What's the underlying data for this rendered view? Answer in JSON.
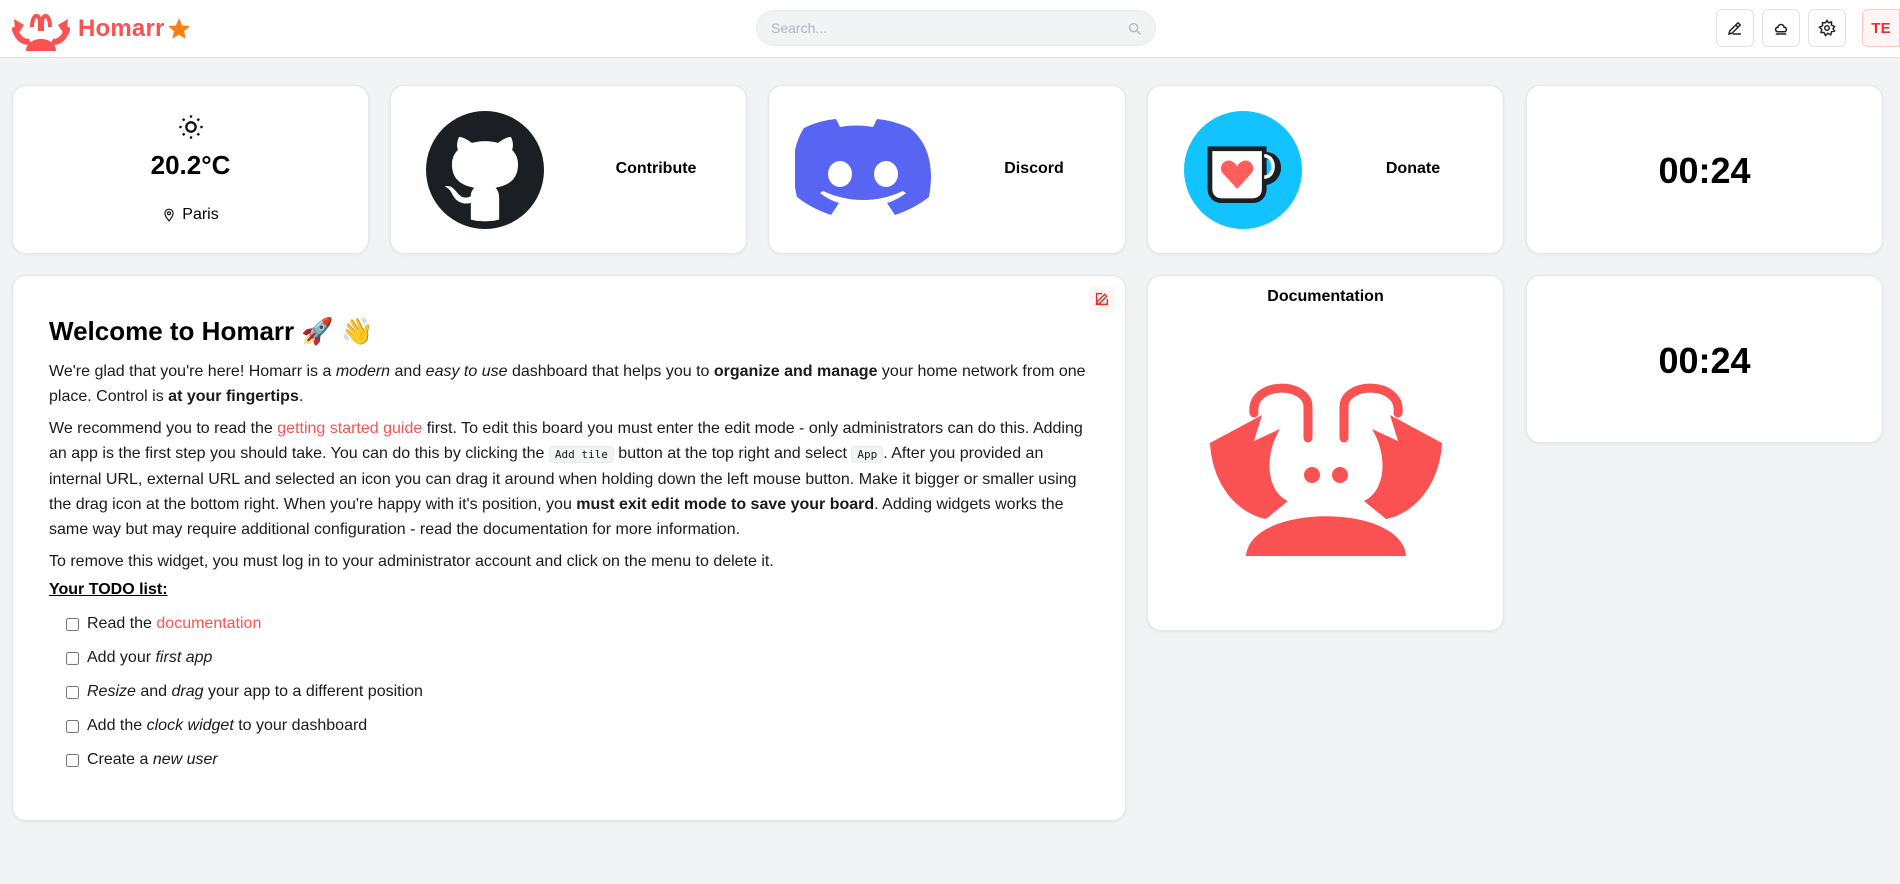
{
  "header": {
    "brand": "Homarr",
    "search_placeholder": "Search...",
    "avatar_initials": "TE",
    "colors": {
      "accent": "#fa5252",
      "star": "#fd7e14"
    }
  },
  "weather": {
    "temperature": "20.2°C",
    "location": "Paris"
  },
  "apps": [
    {
      "label": "Contribute",
      "icon": "github-icon"
    },
    {
      "label": "Discord",
      "icon": "discord-icon"
    },
    {
      "label": "Donate",
      "icon": "ko-fi-icon"
    }
  ],
  "clocks": [
    {
      "time": "00:24"
    },
    {
      "time": "00:24"
    }
  ],
  "documentation": {
    "label": "Documentation",
    "icon": "homarr-logo-icon"
  },
  "welcome": {
    "title": "Welcome to Homarr",
    "title_emoji": "🚀 👋",
    "p1": {
      "t1": "We're glad that you're here! Homarr is a ",
      "i1": "modern",
      "t2": " and ",
      "i2": "easy to use",
      "t3": " dashboard that helps you to ",
      "b1": "organize and manage",
      "t4": " your home network from one place. Control is ",
      "b2": "at your fingertips",
      "t5": "."
    },
    "p2": {
      "t1": "We recommend you to read the ",
      "link": "getting started guide",
      "t2": " first. To edit this board you must enter the edit mode - only administrators can do this. Adding an app is the first step you should take. You can do this by clicking the ",
      "code1": "Add tile",
      "t3": " button at the top right and select ",
      "code2": "App",
      "t4": ". After you provided an internal URL, external URL and selected an icon you can drag it around when holding down the left mouse button. Make it bigger or smaller using the drag icon at the bottom right. When you're happy with it's position, you ",
      "b1": "must exit edit mode to save your board",
      "t5": ". Adding widgets works the same way but may require additional configuration - read the documentation for more information."
    },
    "p3": "To remove this widget, you must log in to your administrator account and click on the menu to delete it.",
    "todo_title": "Your TODO list:",
    "todo": {
      "item1": {
        "t1": "Read the ",
        "link": "documentation"
      },
      "item2": {
        "t1": "Add your ",
        "i1": "first app"
      },
      "item3": {
        "i1": "Resize",
        "t1": " and ",
        "i2": "drag",
        "t2": " your app to a different position"
      },
      "item4": {
        "t1": "Add the ",
        "i1": "clock widget",
        "t2": " to your dashboard"
      },
      "item5": {
        "t1": "Create a ",
        "i1": "new user"
      }
    }
  }
}
